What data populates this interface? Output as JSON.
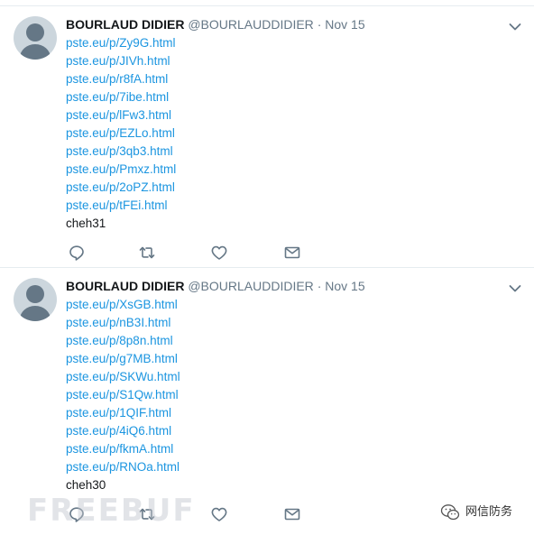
{
  "tweets": [
    {
      "name": "BOURLAUD DIDIER",
      "handle": "@BOURLAUDDIDIER",
      "separator": "·",
      "time": "Nov 15",
      "links": [
        "pste.eu/p/Zy9G.html",
        "pste.eu/p/JIVh.html",
        "pste.eu/p/r8fA.html",
        "pste.eu/p/7ibe.html",
        "pste.eu/p/lFw3.html",
        "pste.eu/p/EZLo.html",
        "pste.eu/p/3qb3.html",
        "pste.eu/p/Pmxz.html",
        "pste.eu/p/2oPZ.html",
        "pste.eu/p/tFEi.html"
      ],
      "text": "cheh31"
    },
    {
      "name": "BOURLAUD DIDIER",
      "handle": "@BOURLAUDDIDIER",
      "separator": "·",
      "time": "Nov 15",
      "links": [
        "pste.eu/p/XsGB.html",
        "pste.eu/p/nB3I.html",
        "pste.eu/p/8p8n.html",
        "pste.eu/p/g7MB.html",
        "pste.eu/p/SKWu.html",
        "pste.eu/p/S1Qw.html",
        "pste.eu/p/1QIF.html",
        "pste.eu/p/4iQ6.html",
        "pste.eu/p/fkmA.html",
        "pste.eu/p/RNOa.html"
      ],
      "text": "cheh30"
    }
  ],
  "icons": {
    "reply": "reply-icon",
    "retweet": "retweet-icon",
    "like": "heart-icon",
    "direct_message": "envelope-icon",
    "more": "chevron-down-icon"
  },
  "colors": {
    "link": "#1b95e0",
    "name": "#14171a",
    "meta": "#657786",
    "icon": "#657786",
    "divider": "#e6ecf0"
  },
  "watermark": "FREEBUF",
  "brand": {
    "label": "网信防务"
  }
}
